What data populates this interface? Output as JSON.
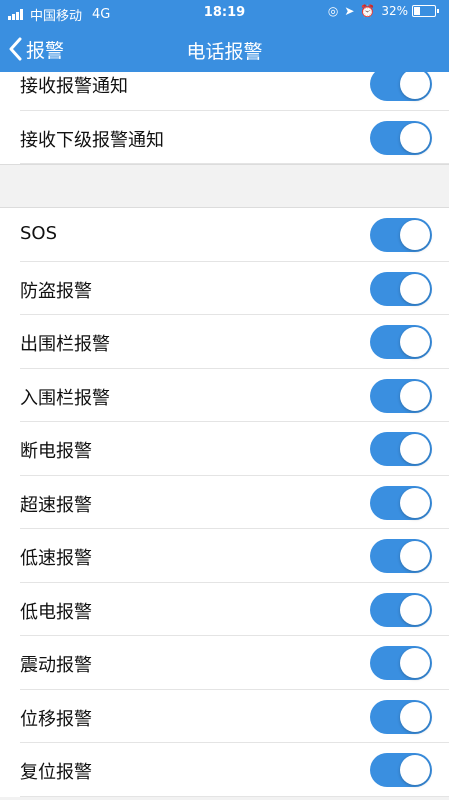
{
  "status_bar": {
    "carrier": "中国移动",
    "network": "4G",
    "time": "18:19",
    "battery": "32%",
    "battery_level": 0.32
  },
  "nav": {
    "back_label": "报警",
    "title": "电话报警"
  },
  "section_top": {
    "items": [
      {
        "label": "接收报警通知",
        "on": true
      },
      {
        "label": "接收下级报警通知",
        "on": true
      }
    ]
  },
  "section_alarms": {
    "items": [
      {
        "label": "SOS",
        "on": true
      },
      {
        "label": "防盗报警",
        "on": true
      },
      {
        "label": "出围栏报警",
        "on": true
      },
      {
        "label": "入围栏报警",
        "on": true
      },
      {
        "label": "断电报警",
        "on": true
      },
      {
        "label": "超速报警",
        "on": true
      },
      {
        "label": "低速报警",
        "on": true
      },
      {
        "label": "低电报警",
        "on": true
      },
      {
        "label": "震动报警",
        "on": true
      },
      {
        "label": "位移报警",
        "on": true
      },
      {
        "label": "复位报警",
        "on": true
      }
    ]
  },
  "colors": {
    "accent": "#3a8fe0",
    "background": "#f2f2f2"
  }
}
